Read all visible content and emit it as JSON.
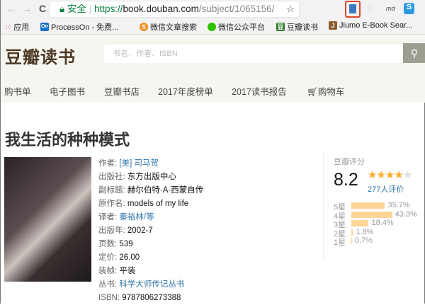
{
  "browser": {
    "back": "←",
    "forward": "→",
    "reload": "C",
    "secure_label": "安全",
    "url_scheme": "https://",
    "url_host": "book.douban.com",
    "url_path": "/subject/1065156/",
    "ext_md": "md"
  },
  "bookmarks": [
    {
      "label": "应用",
      "icon": "apps-icon"
    },
    {
      "label": "ProcessOn - 免费...",
      "icon": "On",
      "color": "#1a73c7"
    },
    {
      "label": "微信文章搜索",
      "icon": "S",
      "color": "#f28a1c"
    },
    {
      "label": "微信公众平台",
      "icon": "wechat-icon",
      "color": "#2dc100"
    },
    {
      "label": "豆瓣读书",
      "icon": "豆",
      "color": "#2b7a2b"
    },
    {
      "label": "Jiumo E-Book Sear...",
      "icon": "J",
      "color": "#8b5a2b"
    }
  ],
  "site": {
    "logo": "豆瓣读书",
    "search_placeholder": "书名、作者、ISBN"
  },
  "nav": [
    "购书单",
    "电子图书",
    "豆瓣书店",
    "2017年度榜单",
    "2017读书报告",
    "购物车"
  ],
  "book": {
    "title": "我生活的种种模式",
    "info": [
      {
        "label": "作者:",
        "value": "[美] 司马贺",
        "link": true
      },
      {
        "label": "出版社:",
        "value": "东方出版中心"
      },
      {
        "label": "副标题:",
        "value": "赫尔伯特·A·西蒙自传"
      },
      {
        "label": "原作名:",
        "value": "models of my life"
      },
      {
        "label": "译者:",
        "value": "秦裕林/等",
        "link": true
      },
      {
        "label": "出版年:",
        "value": "2002-7"
      },
      {
        "label": "页数:",
        "value": "539"
      },
      {
        "label": "定价:",
        "value": "26.00"
      },
      {
        "label": "装帧:",
        "value": "平装"
      },
      {
        "label": "丛书:",
        "value": "科学大师传记丛书",
        "link": true
      },
      {
        "label": "ISBN:",
        "value": "9787806273388"
      }
    ]
  },
  "rating": {
    "heading": "豆瓣评分",
    "score": "8.2",
    "stars": 4,
    "count": "277人评价",
    "dist": [
      {
        "label": "5星",
        "pct": "35.7%",
        "v": 35.7
      },
      {
        "label": "4星",
        "pct": "43.3%",
        "v": 43.3
      },
      {
        "label": "3星",
        "pct": "18.4%",
        "v": 18.4
      },
      {
        "label": "2星",
        "pct": "1.8%",
        "v": 1.8
      },
      {
        "label": "1星",
        "pct": "0.7%",
        "v": 0.7
      }
    ]
  },
  "colors": {
    "link": "#3377aa",
    "star": "#ffac2d",
    "bar": "#ffd596",
    "logo": "#4f3a26"
  }
}
